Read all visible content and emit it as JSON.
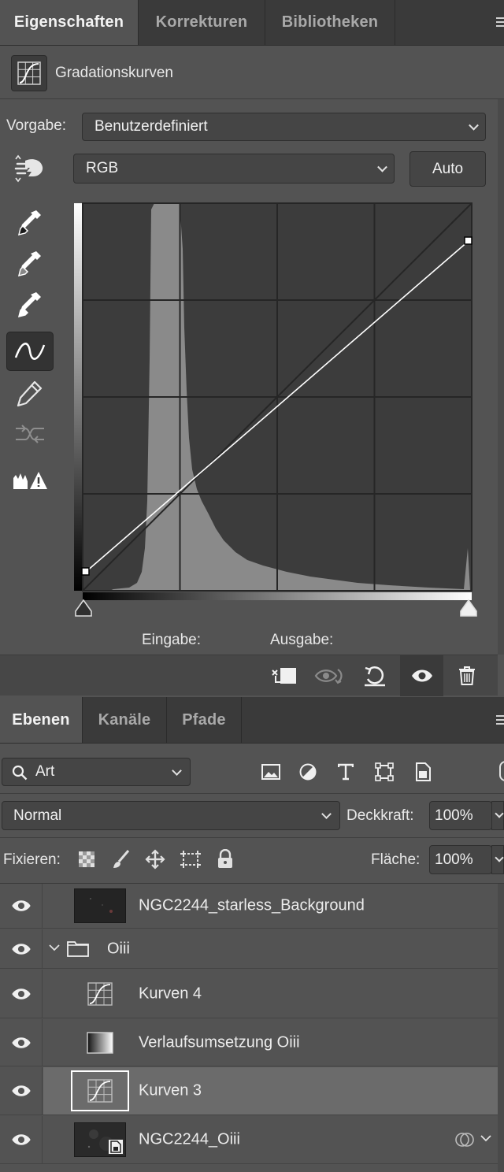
{
  "properties_tabs": [
    "Eigenschaften",
    "Korrekturen",
    "Bibliotheken"
  ],
  "adjustment_title": "Gradationskurven",
  "preset": {
    "label": "Vorgabe:",
    "value": "Benutzerdefiniert"
  },
  "channel": {
    "value": "RGB"
  },
  "auto_button": "Auto",
  "curve_tools": [
    "target-adjust-icon",
    "black-eyedropper-icon",
    "gray-eyedropper-icon",
    "white-eyedropper-icon",
    "curve-point-icon",
    "pencil-icon",
    "smooth-curve-icon",
    "clipping-warning-icon"
  ],
  "curve": {
    "points": [
      [
        0,
        10
      ],
      [
        255,
        230
      ]
    ],
    "histogram_peak_position": "left-quarter"
  },
  "io_labels": {
    "input": "Eingabe:",
    "output": "Ausgabe:"
  },
  "bottom_icons": [
    "clip-to-layer-icon",
    "view-previous-state-icon",
    "reset-icon",
    "visibility-icon",
    "delete-icon"
  ],
  "layers_tabs": [
    "Ebenen",
    "Kanäle",
    "Pfade"
  ],
  "layer_filter": {
    "value": "Art"
  },
  "blend_mode": {
    "value": "Normal"
  },
  "opacity": {
    "label": "Deckkraft:",
    "value": "100%"
  },
  "lock": {
    "label": "Fixieren:"
  },
  "fill": {
    "label": "Fläche:",
    "value": "100%"
  },
  "layers": [
    {
      "name": "NGC2244_starless_Background",
      "kind": "image",
      "visible": true
    },
    {
      "name": "Oiii",
      "kind": "group",
      "visible": true,
      "expanded": true
    },
    {
      "name": "Kurven 4",
      "kind": "curves",
      "visible": true
    },
    {
      "name": "Verlaufsumsetzung Oiii",
      "kind": "gradient-map",
      "visible": true
    },
    {
      "name": "Kurven 3",
      "kind": "curves",
      "visible": true,
      "selected": true
    },
    {
      "name": "NGC2244_Oiii",
      "kind": "smart-object",
      "visible": true
    }
  ]
}
